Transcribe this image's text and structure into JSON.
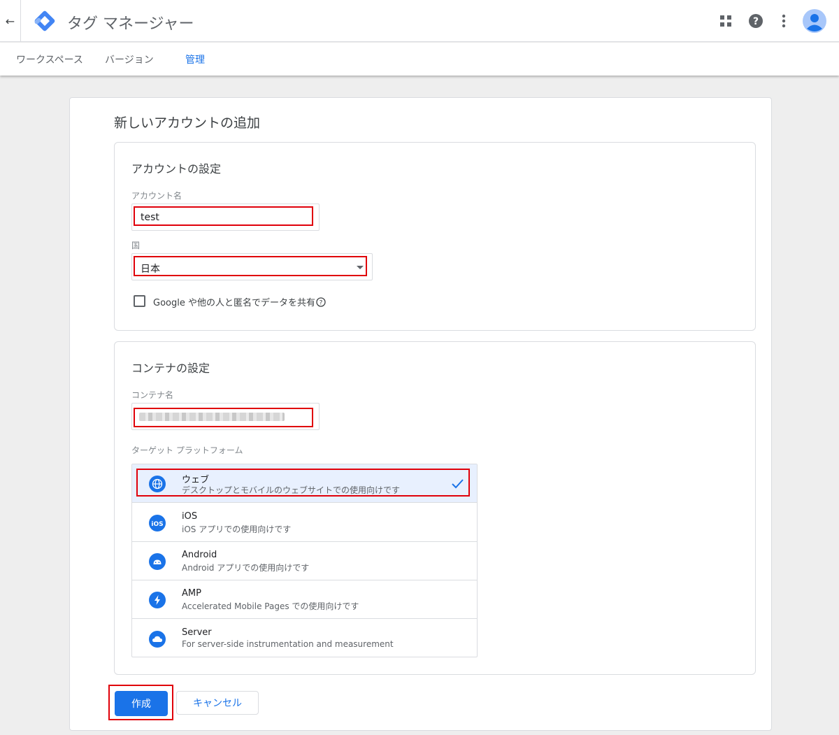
{
  "header": {
    "app_title": "タグ マネージャー",
    "icons": [
      "back-arrow-icon",
      "gtm-logo-icon",
      "apps-grid-icon",
      "help-icon",
      "more-vert-icon",
      "account-avatar-icon"
    ]
  },
  "nav": {
    "tabs": [
      {
        "label": "ワークスペース",
        "active": false
      },
      {
        "label": "バージョン",
        "active": false
      },
      {
        "label": "管理",
        "active": true
      }
    ]
  },
  "page": {
    "title": "新しいアカウントの追加"
  },
  "account_section": {
    "title": "アカウントの設定",
    "account_name_label": "アカウント名",
    "account_name_value": "test",
    "country_label": "国",
    "country_value": "日本",
    "share_data_label": "Google や他の人と匿名でデータを共有",
    "share_data_checked": false
  },
  "container_section": {
    "title": "コンテナの設定",
    "container_name_label": "コンテナ名",
    "target_platform_label": "ターゲット プラットフォーム",
    "platforms": [
      {
        "name": "ウェブ",
        "desc": "デスクトップとモバイルのウェブサイトでの使用向けです",
        "icon": "globe-icon",
        "selected": true
      },
      {
        "name": "iOS",
        "desc": "iOS アプリでの使用向けです",
        "icon": "ios-icon",
        "selected": false
      },
      {
        "name": "Android",
        "desc": "Android アプリでの使用向けです",
        "icon": "android-icon",
        "selected": false
      },
      {
        "name": "AMP",
        "desc": "Accelerated Mobile Pages での使用向けです",
        "icon": "amp-bolt-icon",
        "selected": false
      },
      {
        "name": "Server",
        "desc": "For server-side instrumentation and measurement",
        "icon": "cloud-icon",
        "selected": false
      }
    ]
  },
  "actions": {
    "create_label": "作成",
    "cancel_label": "キャンセル"
  },
  "colors": {
    "accent": "#1a73e8",
    "highlight_border": "#e0000a",
    "selected_bg": "#e8f0fe"
  }
}
